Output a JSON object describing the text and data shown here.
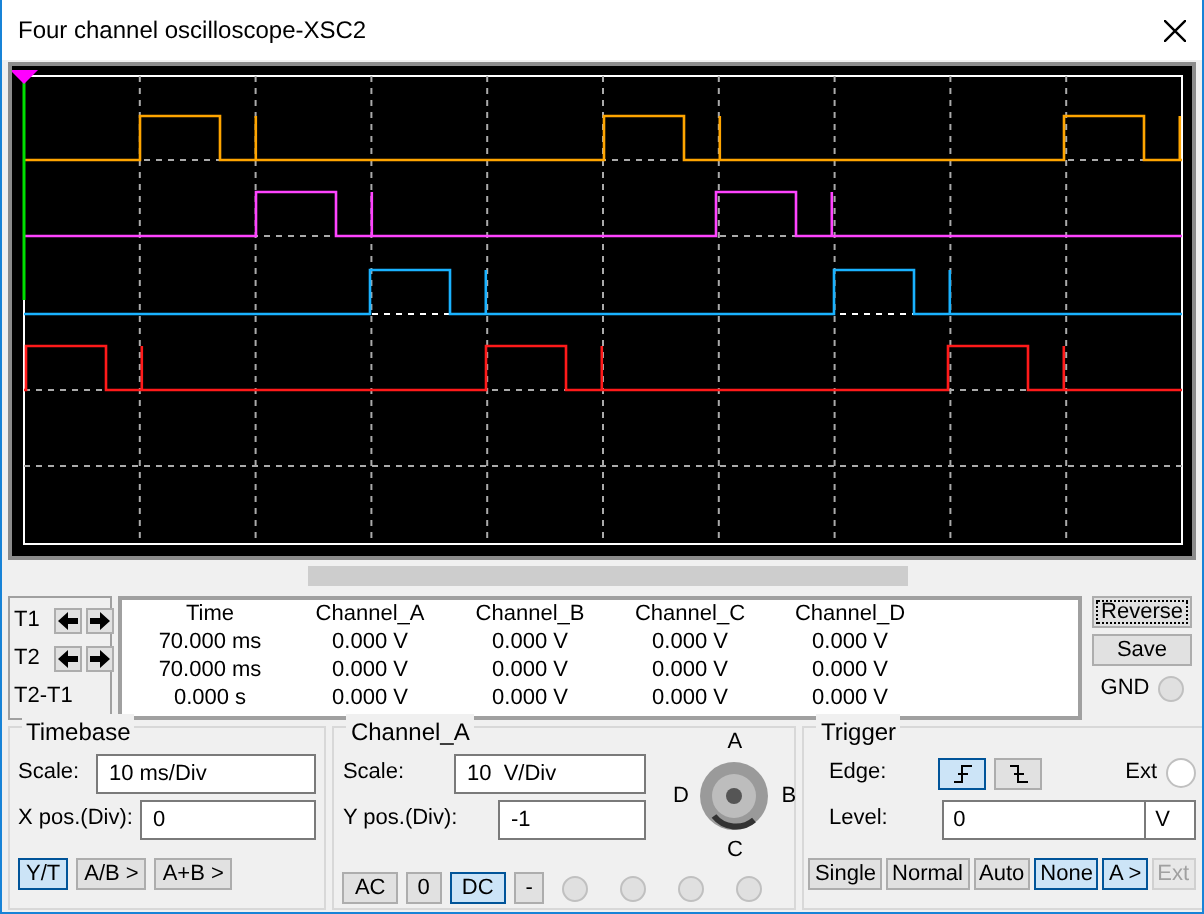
{
  "window": {
    "title": "Four channel oscilloscope-XSC2"
  },
  "cursors": {
    "labels": [
      "T1",
      "T2",
      "T2-T1"
    ]
  },
  "readout": {
    "columns": [
      "Time",
      "Channel_A",
      "Channel_B",
      "Channel_C",
      "Channel_D"
    ],
    "rows": [
      [
        "70.000 ms",
        "0.000 V",
        "0.000 V",
        "0.000 V",
        "0.000 V"
      ],
      [
        "70.000 ms",
        "0.000 V",
        "0.000 V",
        "0.000 V",
        "0.000 V"
      ],
      [
        "0.000 s",
        "0.000 V",
        "0.000 V",
        "0.000 V",
        "0.000 V"
      ]
    ]
  },
  "side_buttons": {
    "reverse": "Reverse",
    "save": "Save",
    "gnd": "GND",
    "gnd_checked": false,
    "gnd_disabled": true
  },
  "timebase": {
    "title": "Timebase",
    "scale_label": "Scale:",
    "scale": "10 ms/Div",
    "xpos_label": "X pos.(Div):",
    "xpos": "0",
    "modes": [
      {
        "label": "Y/T",
        "selected": true
      },
      {
        "label": "A/B >",
        "selected": false
      },
      {
        "label": "A+B >",
        "selected": false
      }
    ]
  },
  "channel": {
    "title": "Channel_A",
    "scale_label": "Scale:",
    "scale": "10  V/Div",
    "ypos_label": "Y pos.(Div):",
    "ypos": "-1",
    "coupling": [
      {
        "label": "AC",
        "selected": false
      },
      {
        "label": "0",
        "selected": false
      },
      {
        "label": "DC",
        "selected": true
      },
      {
        "label": "-",
        "selected": false
      }
    ],
    "knob_labels": {
      "top": "A",
      "right": "B",
      "bottom": "C",
      "left": "D"
    },
    "radios": [
      {
        "checked": false,
        "disabled": true
      },
      {
        "checked": false,
        "disabled": true
      },
      {
        "checked": false,
        "disabled": true
      },
      {
        "checked": false,
        "disabled": true
      }
    ]
  },
  "trigger": {
    "title": "Trigger",
    "edge_label": "Edge:",
    "edges": [
      {
        "kind": "rising",
        "selected": true
      },
      {
        "kind": "falling",
        "selected": false
      }
    ],
    "ext_label": "Ext",
    "ext_checked": false,
    "level_label": "Level:",
    "level": "0",
    "unit": "V",
    "modes": [
      {
        "label": "Single",
        "selected": false,
        "disabled": false
      },
      {
        "label": "Normal",
        "selected": false,
        "disabled": false
      },
      {
        "label": "Auto",
        "selected": false,
        "disabled": false
      },
      {
        "label": "None",
        "selected": true,
        "disabled": false
      },
      {
        "label": "A >",
        "selected": true,
        "disabled": false
      },
      {
        "label": "Ext",
        "selected": false,
        "disabled": true
      }
    ]
  }
}
